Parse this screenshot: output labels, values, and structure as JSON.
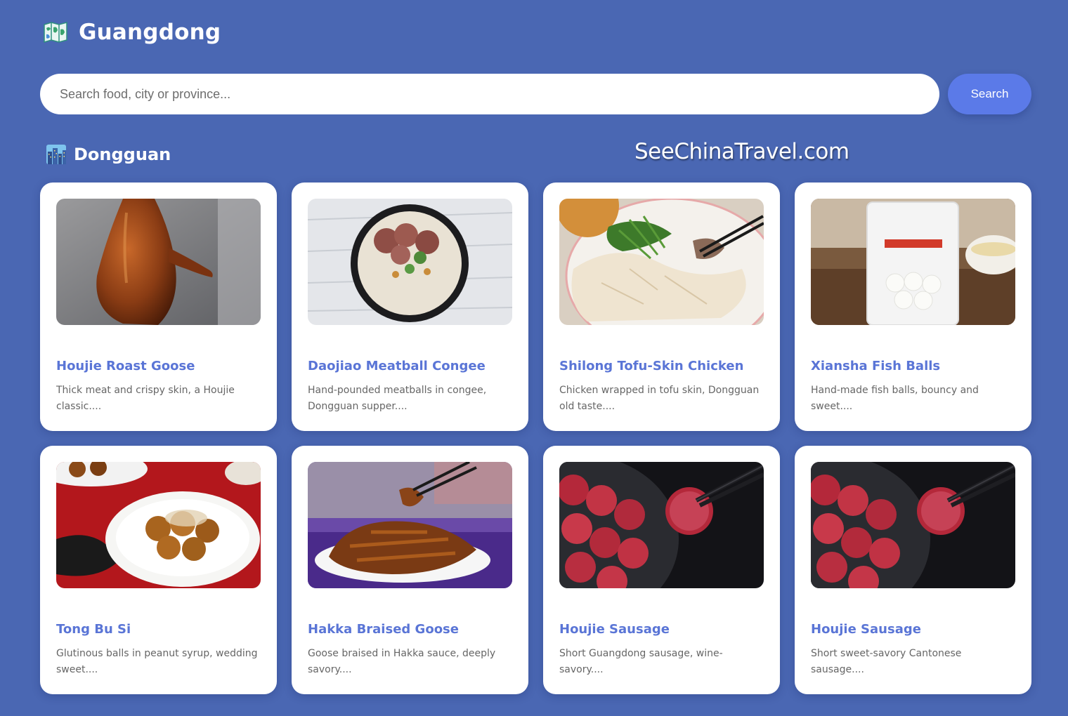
{
  "app": {
    "title": "Guangdong",
    "icon": "map-icon"
  },
  "search": {
    "placeholder": "Search food, city or province...",
    "value": "",
    "button_label": "Search"
  },
  "section": {
    "title": "Dongguan",
    "icon": "cityscape-icon",
    "watermark": "SeeChinaTravel.com"
  },
  "colors": {
    "background": "#4a67b3",
    "accent": "#5b7ae8",
    "card_title": "#5a75d6"
  },
  "cards": [
    {
      "title": "Houjie Roast Goose",
      "desc": "Thick meat and crispy skin, a Houjie classic....",
      "image": "roast-goose-photo"
    },
    {
      "title": "Daojiao Meatball Congee",
      "desc": "Hand-pounded meatballs in congee, Dongguan supper....",
      "image": "meatball-congee-photo"
    },
    {
      "title": "Shilong Tofu-Skin Chicken",
      "desc": "Chicken wrapped in tofu skin, Dongguan old taste....",
      "image": "tofu-skin-chicken-photo"
    },
    {
      "title": "Xiansha Fish Balls",
      "desc": "Hand-made fish balls, bouncy and sweet....",
      "image": "fish-balls-photo"
    },
    {
      "title": "Tong Bu Si",
      "desc": "Glutinous balls in peanut syrup, wedding sweet....",
      "image": "glutinous-balls-photo"
    },
    {
      "title": "Hakka Braised Goose",
      "desc": "Goose braised in Hakka sauce, deeply savory....",
      "image": "braised-goose-photo"
    },
    {
      "title": "Houjie Sausage",
      "desc": "Short Guangdong sausage, wine-savory....",
      "image": "sausage-photo"
    },
    {
      "title": "Houjie Sausage",
      "desc": "Short sweet-savory Cantonese sausage....",
      "image": "sausage-photo"
    }
  ]
}
